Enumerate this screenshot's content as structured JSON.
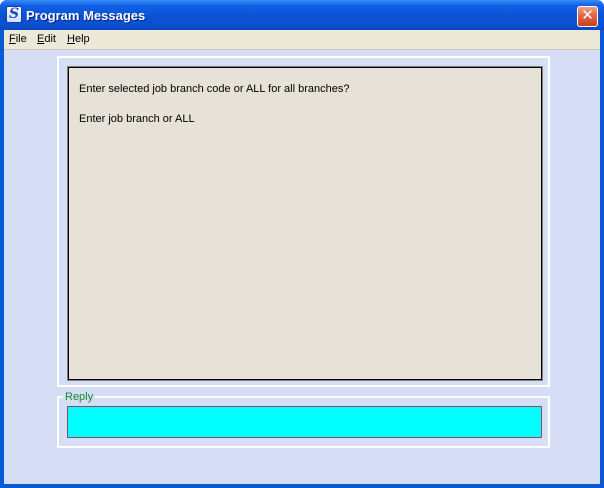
{
  "window": {
    "title": "Program Messages",
    "app_icon_glyph": "S",
    "close_glyph": "✕"
  },
  "menu": {
    "items": [
      {
        "mnemonic": "F",
        "rest": "ile"
      },
      {
        "mnemonic": "E",
        "rest": "dit"
      },
      {
        "mnemonic": "H",
        "rest": "elp"
      }
    ]
  },
  "messages": {
    "lines": [
      "Enter selected job branch code or ALL for all branches?",
      "Enter job branch or ALL"
    ]
  },
  "reply": {
    "label": "Reply",
    "value": ""
  },
  "colors": {
    "titlebar": "#0a52d4",
    "client_bg": "#d5def4",
    "message_bg": "#e6e2d8",
    "reply_bg": "#00ffff",
    "reply_label": "#118833"
  }
}
